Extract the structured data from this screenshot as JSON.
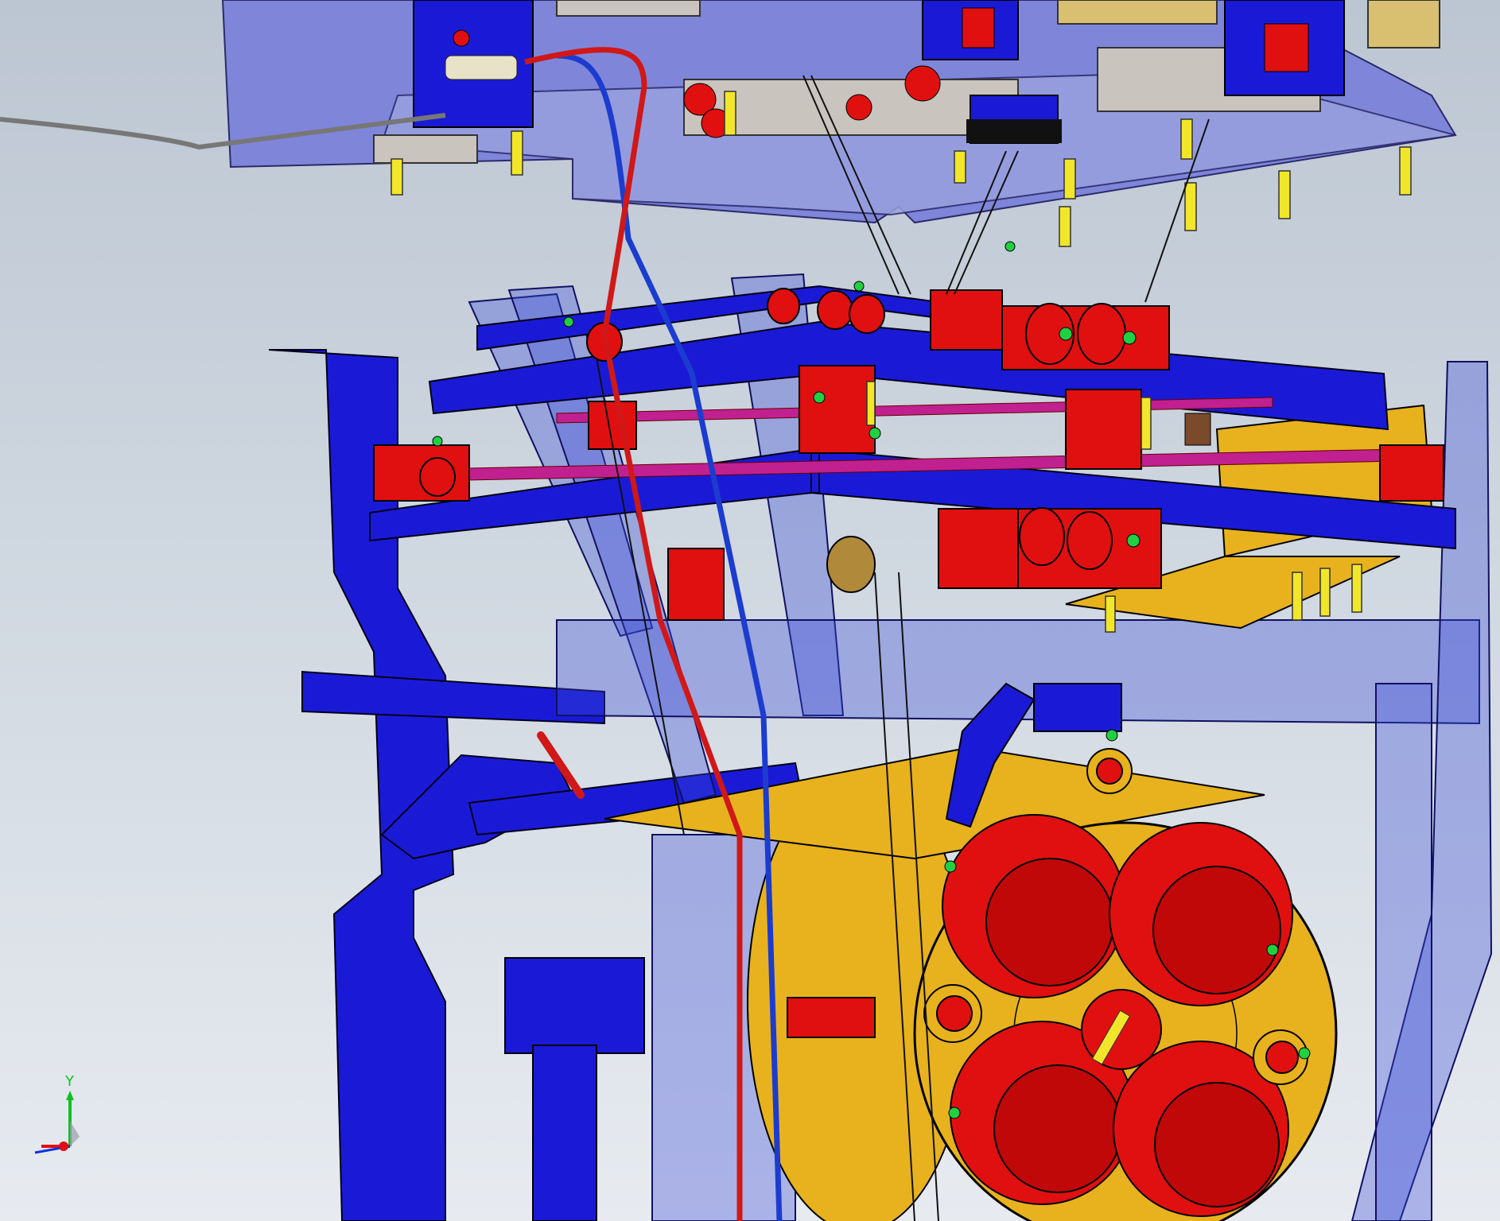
{
  "viewport": {
    "background_top": "#bcc6d2",
    "background_bottom": "#e7ebf0"
  },
  "triad": {
    "y_label": "Y",
    "x_color": "#e01010",
    "y_color": "#10c020",
    "z_color": "#1030e0"
  },
  "colors": {
    "frame_blue": "#1a1ad6",
    "translucent_blue": "#3a4ad8",
    "housing_lavender": "#7c83d8",
    "bracket_red": "#e01010",
    "flange_gold": "#e8b21e",
    "bolt_yellow": "#f2e62a",
    "washer_green": "#20d040",
    "tube_red": "#d01818",
    "tube_blue": "#1c3ccf",
    "rail_magenta": "#c02090"
  }
}
